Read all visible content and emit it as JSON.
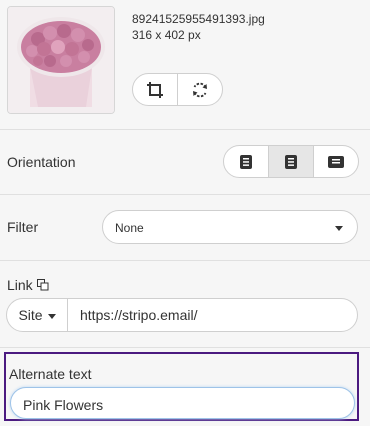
{
  "image": {
    "filename": "89241525955491393.jpg",
    "dimensions": "316 x 402 px",
    "thumbnail_alt": "pink roses bouquet thumbnail"
  },
  "image_tools": {
    "crop_icon": "crop-icon",
    "replace_icon": "refresh-icon"
  },
  "orientation": {
    "label": "Orientation",
    "options": [
      "align-left",
      "align-center",
      "align-right"
    ],
    "selected": "align-center"
  },
  "filter": {
    "label": "Filter",
    "value": "None"
  },
  "link": {
    "label": "Link",
    "icon": "copy-icon",
    "type": "Site",
    "url": "https://stripo.email/"
  },
  "alternate_text": {
    "label": "Alternate text",
    "value": "Pink Flowers"
  },
  "colors": {
    "focus_border": "#4b1a80",
    "input_focus": "#9ec3e8"
  }
}
